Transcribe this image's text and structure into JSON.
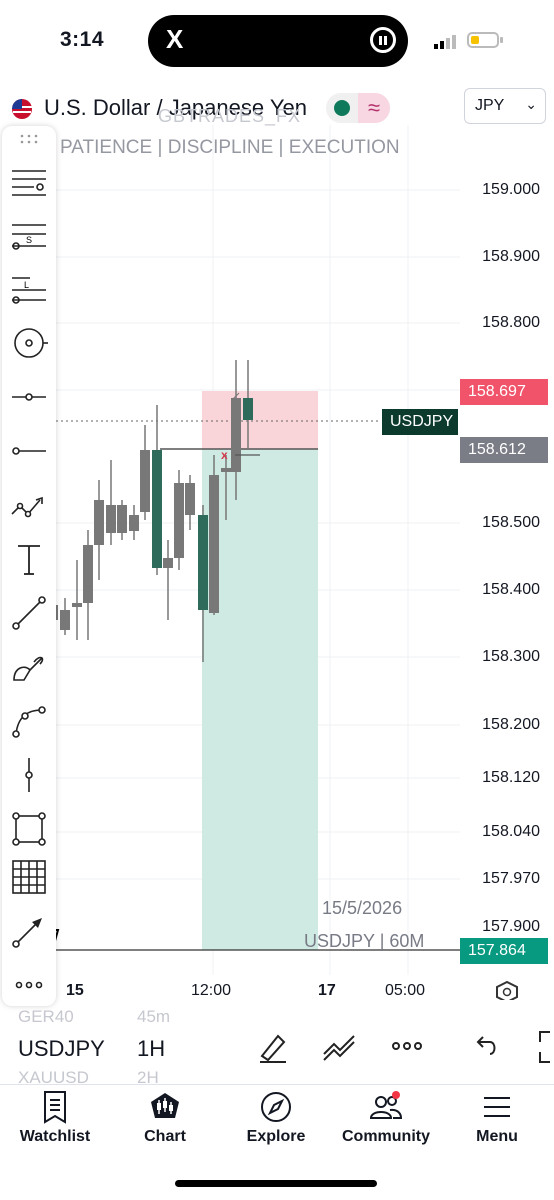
{
  "status_bar": {
    "time": "3:14",
    "island_app": "X"
  },
  "header": {
    "symbol_title": "U.S. Dollar / Japanese Yen",
    "currency": "JPY",
    "watermark_top": "GBTRADES_FX",
    "watermark_motto": "PATIENCE | DISCIPLINE | EXECUTION"
  },
  "toolbar": {
    "tools": [
      "crosshair-lines-tool",
      "short-position-tool",
      "long-position-tool",
      "cursor-target-tool",
      "horizontal-ray-tool",
      "horizontal-line-tool",
      "trend-pattern-tool",
      "text-tool",
      "trend-line-tool",
      "brush-tool",
      "curve-tool",
      "vertical-line-tool",
      "rectangle-tool",
      "grid-tool",
      "arrow-tool",
      "more-tools"
    ]
  },
  "price_scale": {
    "ticks": [
      "159.000",
      "158.900",
      "158.800",
      "158.500",
      "158.400",
      "158.300",
      "158.200",
      "158.120",
      "158.040",
      "157.970",
      "157.900"
    ],
    "stop_price": "158.697",
    "symbol_tag": "USDJPY",
    "entry_price": "158.612",
    "target_price": "157.864",
    "colors": {
      "stop": "#f23645",
      "entry": "#787b86",
      "target": "#089981",
      "symbol_tag": "#0c3b2e"
    }
  },
  "chart_labels": {
    "date": "15/5/2026",
    "symbol_interval": "USDJPY | 60M"
  },
  "time_axis": {
    "labels": [
      "15",
      "12:00",
      "17",
      "05:00"
    ]
  },
  "bottom_bar": {
    "symbol": "USDJPY",
    "interval": "1H",
    "ghost_symbol_1": "GER40",
    "ghost_interval_1": "45m",
    "ghost_symbol_2": "XAUUSD",
    "ghost_interval_2": "2H"
  },
  "nav": [
    {
      "label": "Watchlist",
      "icon": "watchlist-icon"
    },
    {
      "label": "Chart",
      "icon": "chart-icon"
    },
    {
      "label": "Explore",
      "icon": "compass-icon"
    },
    {
      "label": "Community",
      "icon": "community-icon"
    },
    {
      "label": "Menu",
      "icon": "menu-icon"
    }
  ]
}
